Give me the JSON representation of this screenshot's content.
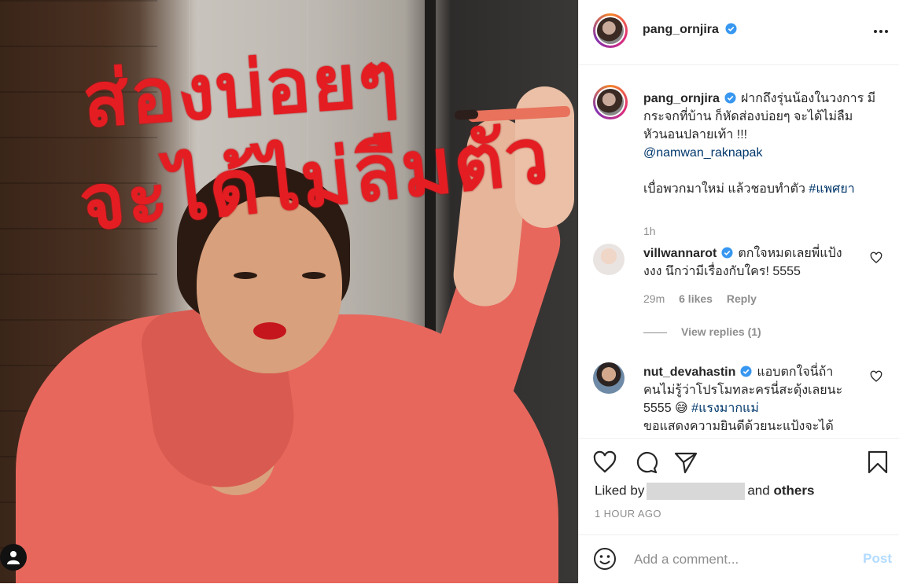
{
  "post": {
    "author": "pang_ornjira",
    "image_text_line1": "ส่องบ่อยๆ",
    "image_text_line2": "จะได้ไม่ลืมตัว",
    "caption_line1": "ฝากถึงรุ่นน้องในวงการ มี",
    "caption_line2": "กระจกที่บ้าน ก็หัดส่องบ่อยๆ จะได้ไม่ลืม",
    "caption_line3": "หัวนอนปลายเท้า !!!",
    "caption_mention": "@namwan_raknapak",
    "caption_line5": "เบื่อพวกมาใหม่ แล้วชอบทำตัว",
    "caption_hashtag": "#แพศยา",
    "caption_time": "1h"
  },
  "comments": [
    {
      "username": "villwannarot",
      "text_line1": "ตกใจหมดเลยพี่แป้ง",
      "text_line2": "งงง นึกว่ามีเรื่องกับใคร! 5555",
      "time": "29m",
      "likes": "6 likes",
      "reply": "Reply",
      "view_replies": "View replies (1)"
    },
    {
      "username": "nut_devahastin",
      "text_line1": "แอบตกใจนี่ถ้า",
      "text_line2": "คนไม่รู้ว่าโปรโมทละครนี่สะดุ้งเลยนะ",
      "text_line3": "5555 😅",
      "hashtag": "#แรงมากแม่",
      "text_line4": "ขอแสดงความยินดีด้วยนะแป้งจะได้"
    }
  ],
  "likes": {
    "prefix": "Liked by",
    "suffix": "and",
    "others": "others"
  },
  "timestamp": "1 HOUR AGO",
  "composer": {
    "placeholder": "Add a comment...",
    "post_label": "Post"
  },
  "colors": {
    "verified": "#3897f0",
    "link": "#00376b",
    "muted": "#8e8e8e",
    "post_disabled": "#b3dbff"
  },
  "icons": {
    "more": "more-dots-icon",
    "like": "heart-icon",
    "comment": "comment-bubble-icon",
    "share": "paper-plane-icon",
    "save": "bookmark-icon",
    "emoji": "smiley-icon",
    "verified": "verified-badge-icon",
    "profile": "user-icon"
  }
}
